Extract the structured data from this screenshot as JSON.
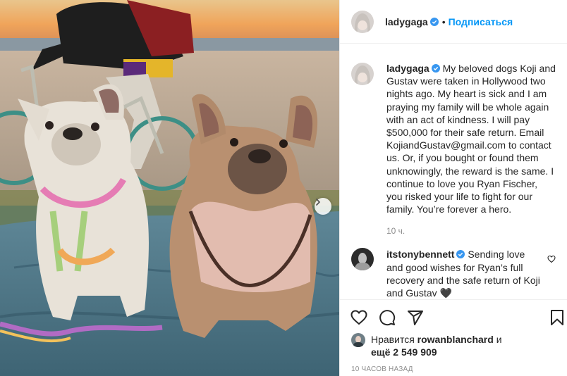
{
  "post": {
    "author": "ladygaga",
    "follow_label": "Подписаться",
    "dot": "•",
    "caption": "My beloved dogs Koji and Gustav were taken in Hollywood two nights ago. My heart is sick and I am praying my family will be whole again with an act of kindness. I will pay $500,000 for their safe return. Email KojiandGustav@gmail.com to contact us. Or, if you bought or found them unknowingly, the reward is the same. I continue to love you Ryan Fischer, you risked your life to fight for our family. You’re forever a hero.",
    "caption_time": "10 ч.",
    "verified_icon": "verified-badge-icon",
    "accent_color": "#0095f6"
  },
  "comments": [
    {
      "user": "itstonybennett",
      "text": "Sending love and good wishes for Ryan’s full recovery and the safe return of Koji and Gustav 🖤"
    }
  ],
  "engagement": {
    "likes_prefix": "Нравится",
    "liker": "rowanblanchard",
    "likes_and": "и",
    "likes_more": "ещё 2 549 909",
    "posted_ago": "10 ЧАСОВ НАЗАД"
  },
  "icons": [
    "heart-icon",
    "comment-icon",
    "share-icon",
    "bookmark-icon",
    "chevron-right-icon"
  ]
}
